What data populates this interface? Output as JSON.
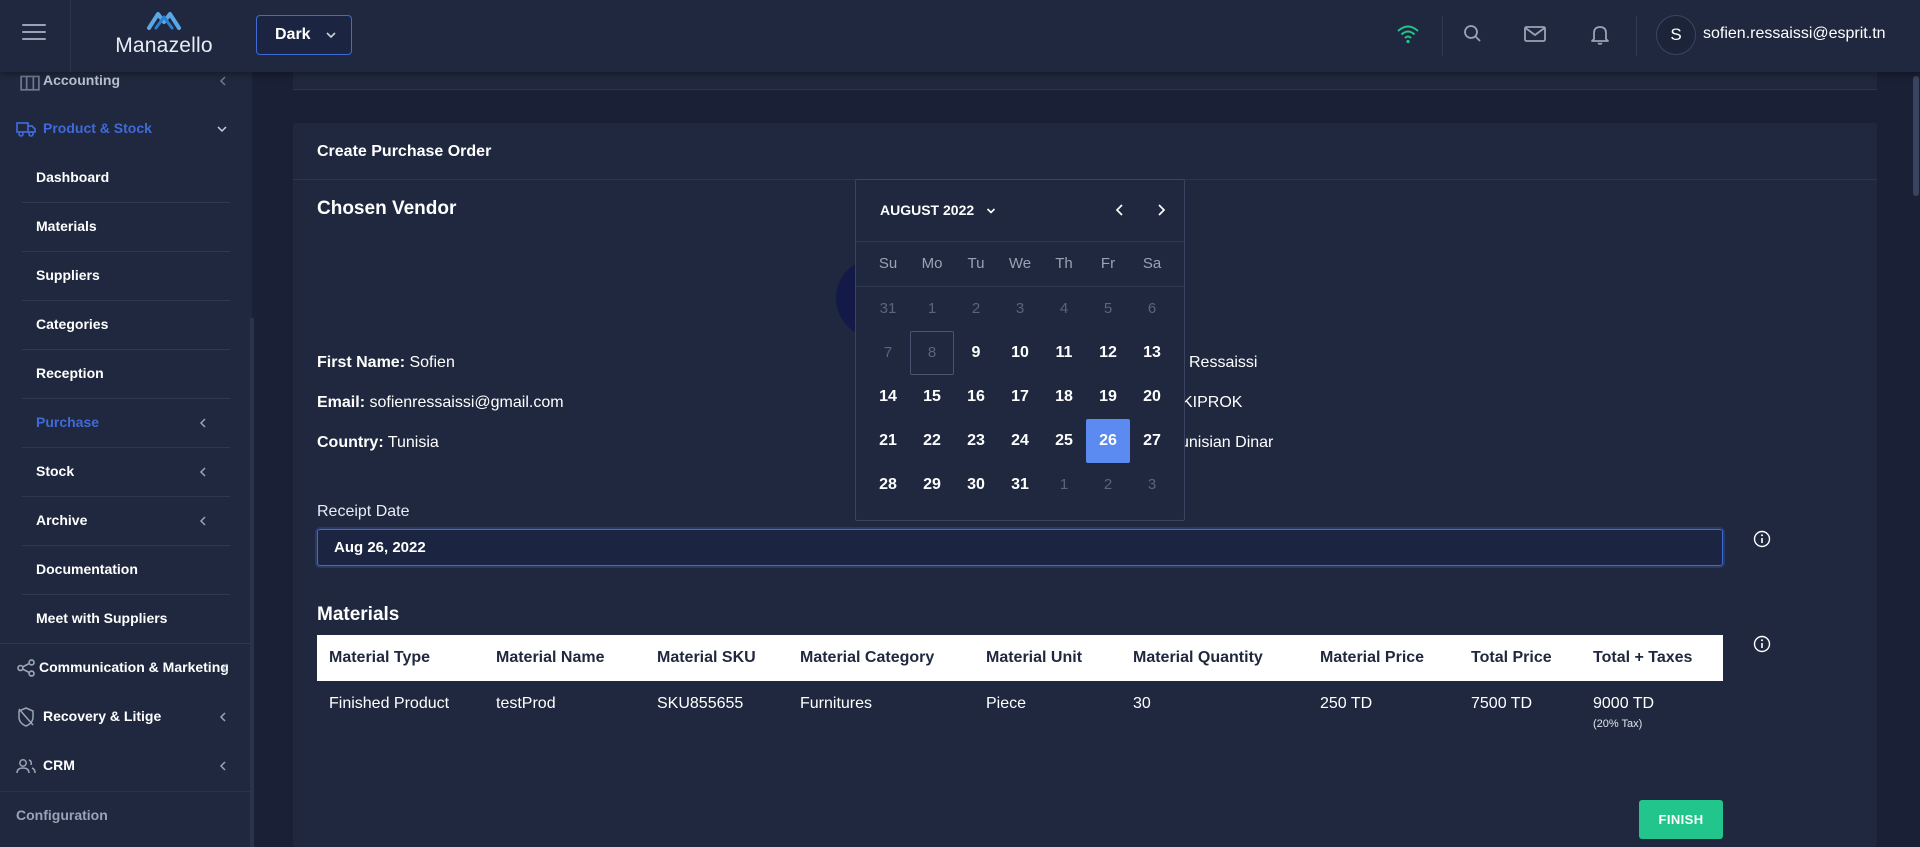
{
  "topbar": {
    "logo_text": "Manazello",
    "theme_value": "Dark",
    "user_initial": "S",
    "user_email": "sofien.ressaissi@esprit.tn",
    "colors": {
      "wifi": "#22c58b",
      "accent": "#3f6ad8"
    }
  },
  "sidebar": {
    "items": [
      {
        "label": "Accounting",
        "icon": "accounting-icon"
      },
      {
        "label": "Product & Stock",
        "icon": "truck-icon",
        "active": true
      },
      {
        "label": "Dashboard"
      },
      {
        "label": "Materials"
      },
      {
        "label": "Suppliers"
      },
      {
        "label": "Categories"
      },
      {
        "label": "Reception"
      },
      {
        "label": "Purchase",
        "active": true
      },
      {
        "label": "Stock"
      },
      {
        "label": "Archive"
      },
      {
        "label": "Documentation"
      },
      {
        "label": "Meet with Suppliers"
      },
      {
        "label": "Communication & Marketing",
        "icon": "share-icon"
      },
      {
        "label": "Recovery & Litige",
        "icon": "shield-off-icon"
      },
      {
        "label": "CRM",
        "icon": "users-icon"
      },
      {
        "label": "Configuration"
      }
    ],
    "active_color": "#3f6ad8"
  },
  "card": {
    "title": "Create Purchase Order",
    "vendor_section_title": "Chosen Vendor",
    "vendor": {
      "first_name_label": "First Name:",
      "first_name": "Sofien",
      "last_name_partial": "Ressaissi",
      "email_label": "Email:",
      "email": "sofienressaissi@gmail.com",
      "company_partial": "KIPROK",
      "country_label": "Country:",
      "country": "Tunisia",
      "currency_partial": "unisian Dinar"
    },
    "receipt_date_label": "Receipt Date",
    "receipt_date_value": "Aug 26, 2022",
    "materials_title": "Materials",
    "table": {
      "headers": [
        "Material Type",
        "Material Name",
        "Material SKU",
        "Material Category",
        "Material Unit",
        "Material Quantity",
        "Material Price",
        "Total Price",
        "Total + Taxes"
      ],
      "rows": [
        [
          "Finished Product",
          "testProd",
          "SKU855655",
          "Furnitures",
          "Piece",
          "30",
          "250 TD",
          "7500 TD",
          "9000 TD"
        ]
      ],
      "tax_note": "(20% Tax)"
    },
    "finish_label": "FINISH",
    "finish_color": "#22c58b"
  },
  "calendar": {
    "month_label": "AUGUST 2022",
    "weekdays": [
      "Su",
      "Mo",
      "Tu",
      "We",
      "Th",
      "Fr",
      "Sa"
    ],
    "weeks": [
      [
        "31",
        "1",
        "2",
        "3",
        "4",
        "5",
        "6"
      ],
      [
        "7",
        "8",
        "9",
        "10",
        "11",
        "12",
        "13"
      ],
      [
        "14",
        "15",
        "16",
        "17",
        "18",
        "19",
        "20"
      ],
      [
        "21",
        "22",
        "23",
        "24",
        "25",
        "26",
        "27"
      ],
      [
        "28",
        "29",
        "30",
        "31",
        "1",
        "2",
        "3"
      ]
    ],
    "selected_day": "26",
    "selected_color": "#5b8af0"
  }
}
